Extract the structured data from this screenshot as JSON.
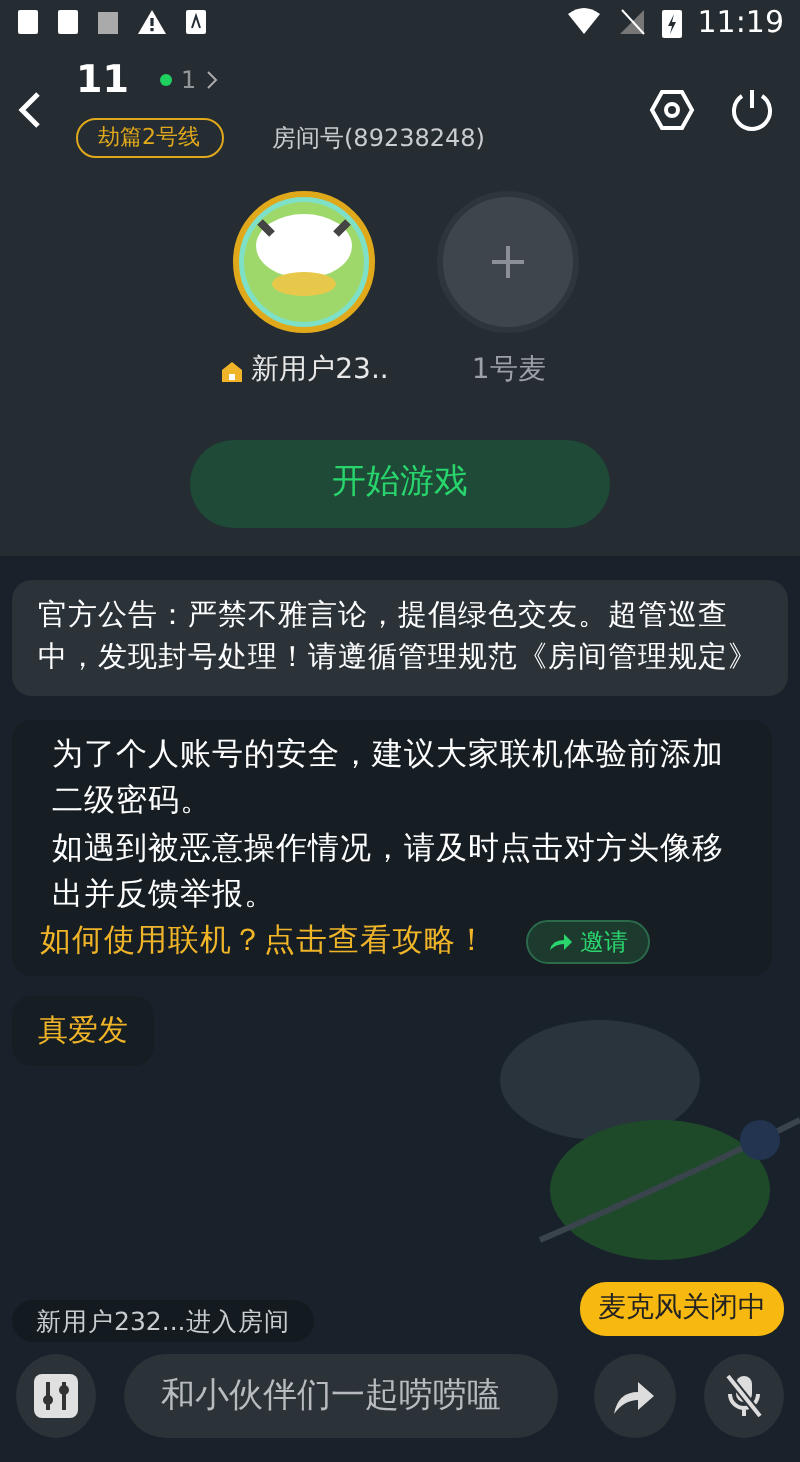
{
  "status_bar": {
    "time": "11:19"
  },
  "header": {
    "room_name": "11",
    "online_count": "1",
    "line_tag": "劫篇2号线",
    "room_number": "房间号(89238248)"
  },
  "seats": [
    {
      "kind": "user",
      "name": "新用户23..",
      "host": true
    },
    {
      "kind": "empty",
      "name": "1号麦"
    }
  ],
  "start_button": "开始游戏",
  "announcement": {
    "text": "官方公告：严禁不雅言论，提倡绿色交友。超管巡查中，发现封号处理！请遵循管理规范",
    "link": "《房间管理规定》"
  },
  "tip": {
    "lines": [
      "为了个人账号的安全，建议大家联机体验前添加二级密码。",
      "如遇到被恶意操作情况，请及时点击对方头像移出并反馈举报。"
    ],
    "guide_link": "如何使用联机？点击查看攻略！",
    "invite_button": "邀请"
  },
  "messages": [
    {
      "text": "真爱发"
    }
  ],
  "join_notice": "新用户232...进入房间",
  "mic_tooltip": "麦克风关闭中",
  "input": {
    "placeholder": "和小伙伴们一起唠唠嗑"
  },
  "mic": {
    "muted": true
  }
}
